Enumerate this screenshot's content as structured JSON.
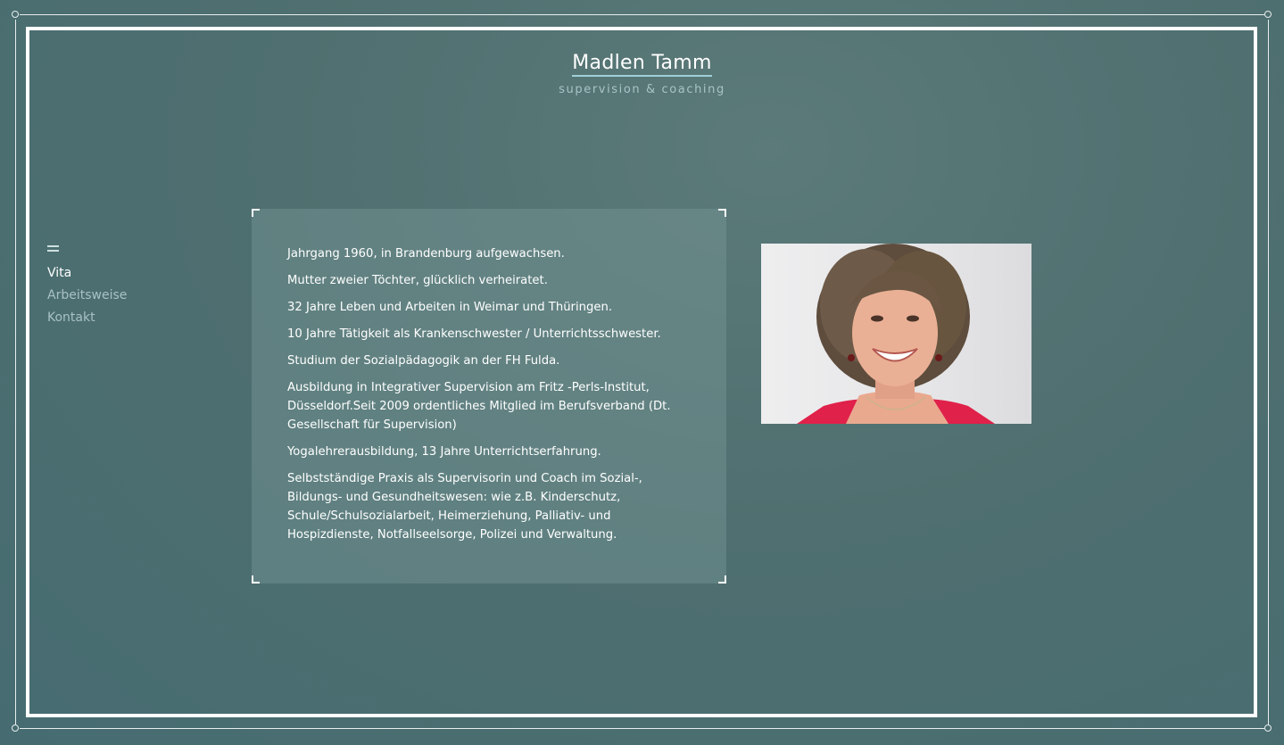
{
  "header": {
    "title": "Madlen Tamm",
    "tagline": "supervision & coaching"
  },
  "nav": {
    "items": [
      {
        "label": "Vita",
        "active": true
      },
      {
        "label": "Arbeitsweise",
        "active": false
      },
      {
        "label": "Kontakt",
        "active": false
      }
    ]
  },
  "vita": {
    "paragraphs": [
      "Jahrgang 1960, in Brandenburg aufgewachsen.",
      "Mutter zweier Töchter, glücklich verheiratet.",
      "32 Jahre Leben und Arbeiten in Weimar und Thüringen.",
      "10 Jahre Tätigkeit als Krankenschwester / Unterrichtsschwester.",
      "Studium der Sozialpädagogik an der FH Fulda.",
      "Ausbildung in Integrativer Supervision am Fritz -Perls-Institut, Düsseldorf.Seit 2009 ordentliches Mitglied im Berufsverband (Dt. Gesellschaft für Supervision)",
      "Yogalehrerausbildung, 13 Jahre Unterrichtserfahrung.",
      "Selbstständige Praxis als Supervisorin und Coach im Sozial-, Bildungs- und Gesundheitswesen: wie z.B. Kinderschutz, Schule/Schulsozialarbeit, Heimerziehung, Palliativ- und Hospizdienste, Notfallseelsorge, Polizei und Verwaltung."
    ]
  },
  "colors": {
    "background": "#4f6f70",
    "frame": "#ffffff",
    "title_underline": "#9fd0d8",
    "nav_inactive": "#a8c1c4",
    "portrait_top_accent": "#e0214a"
  },
  "icons": {
    "menu": "hamburger-menu-icon"
  }
}
